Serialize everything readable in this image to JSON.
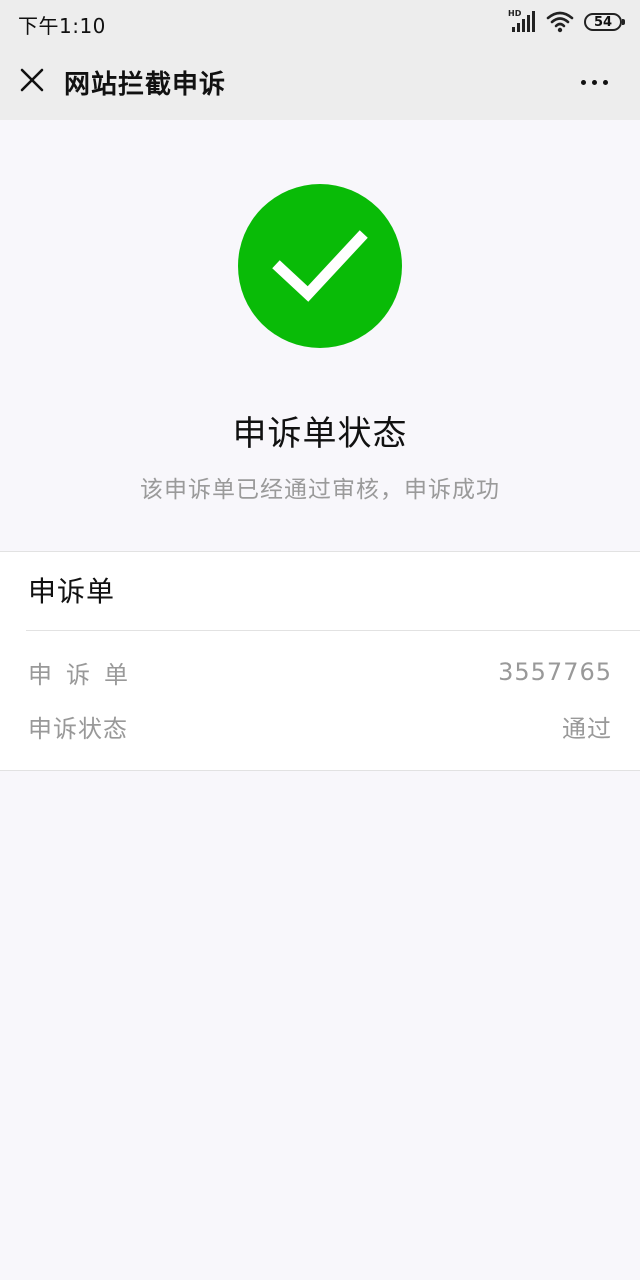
{
  "status_bar": {
    "time": "下午1:10",
    "network_label": "HD",
    "battery": "54"
  },
  "nav": {
    "title": "网站拦截申诉",
    "close_icon": "close-icon",
    "more_icon": "more-icon"
  },
  "result": {
    "icon": "success-check-icon",
    "icon_color": "#09bb07",
    "title": "申诉单状态",
    "description": "该申诉单已经通过审核，申诉成功"
  },
  "card": {
    "header": "申诉单",
    "rows": [
      {
        "label": "申诉单",
        "value": "3557765"
      },
      {
        "label": "申诉状态",
        "value": "通过"
      }
    ]
  }
}
